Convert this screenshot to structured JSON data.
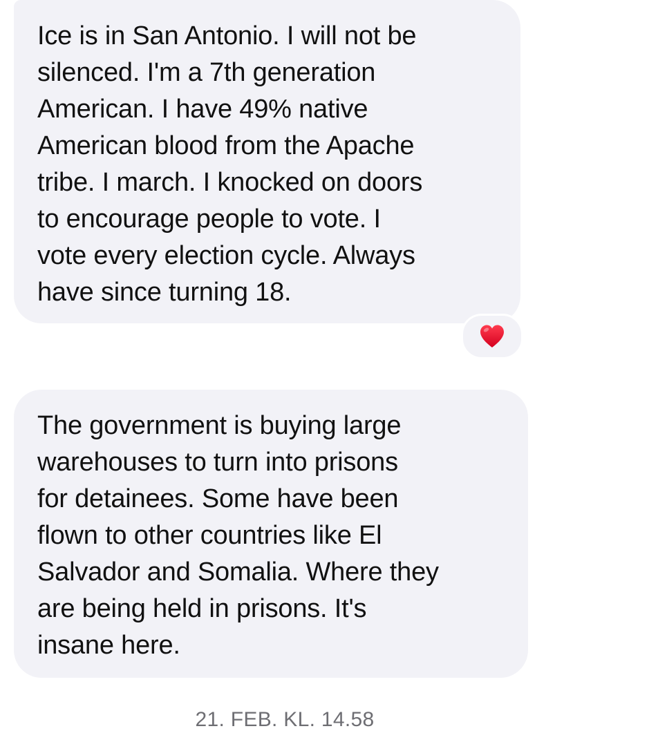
{
  "conversation": {
    "messages": [
      {
        "text": "Ice is in San Antonio.  I will not be\nsilenced.  I'm a 7th generation\nAmerican.  I have 49% native\nAmerican blood from the Apache\ntribe. I march. I knocked on doors\nto encourage people to vote. I\nvote every election cycle.  Always\nhave since turning 18.",
        "reaction": "heart-icon"
      },
      {
        "text": "The government is buying large\nwarehouses to turn into prisons\nfor detainees.  Some have been\nflown to other countries like El\nSalvador and Somalia. Where they\nare being held in prisons.  It's\ninsane here."
      }
    ],
    "timestamp": "21. FEB. KL. 14.58"
  },
  "colors": {
    "bubble_background": "#f2f2f7",
    "text": "#111111",
    "timestamp": "#6e6e73",
    "heart": "#e8112d"
  }
}
